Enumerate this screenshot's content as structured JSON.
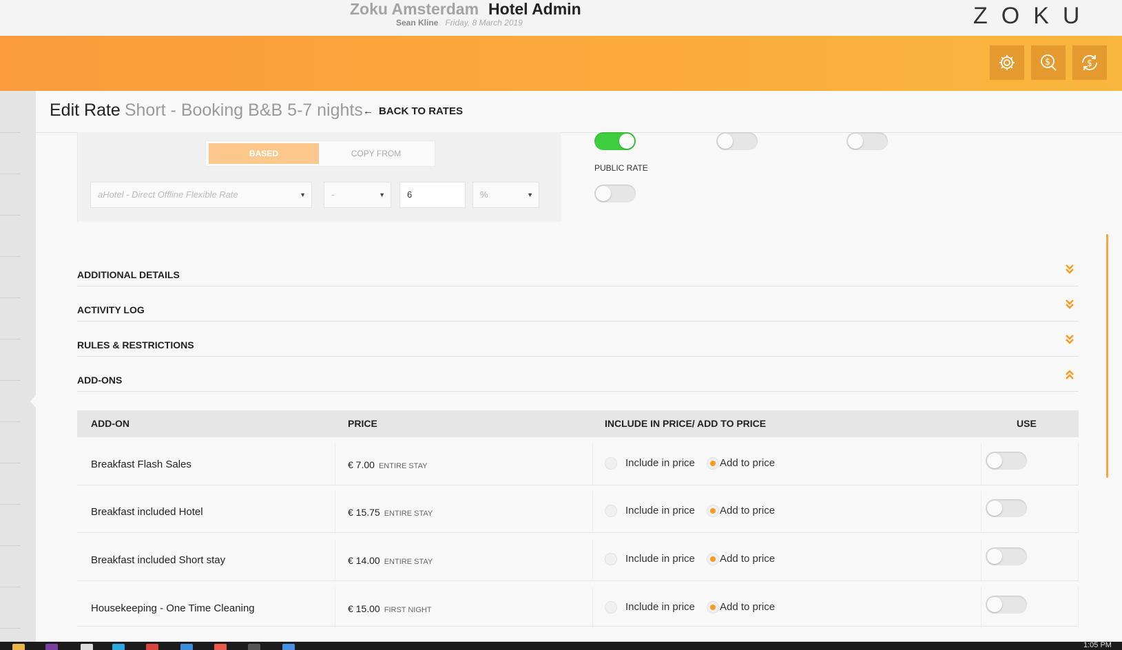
{
  "header": {
    "hotel_name": "Zoku Amsterdam",
    "app_name": "Hotel Admin",
    "user": "Sean Kline",
    "date": "Friday, 8 March 2019",
    "logo": "ZOKU"
  },
  "toolbar": {
    "icons": [
      "gear-icon",
      "dollar-search-icon",
      "dollar-refresh-icon"
    ]
  },
  "page": {
    "title_label": "Edit Rate",
    "rate_name": "Short - Booking B&B 5-7 nights",
    "back_label": "BACK TO RATES"
  },
  "based_panel": {
    "tab_based": "BASED",
    "tab_copy_from": "COPY FROM",
    "base_rate": "aHotel - Direct Offline Flexible Rate",
    "operator": "-",
    "amount": "6",
    "unit": "%"
  },
  "toggles": {
    "public_rate_label": "PUBLIC RATE",
    "row1": [
      true,
      false,
      false
    ],
    "public_rate": false
  },
  "accordion": [
    {
      "title": "ADDITIONAL DETAILS",
      "expanded": false
    },
    {
      "title": "ACTIVITY LOG",
      "expanded": false
    },
    {
      "title": "RULES & RESTRICTIONS",
      "expanded": false
    },
    {
      "title": "ADD-ONS",
      "expanded": true
    }
  ],
  "addons": {
    "columns": [
      "ADD-ON",
      "PRICE",
      "INCLUDE IN PRICE/ ADD TO PRICE",
      "USE"
    ],
    "include_label": "Include in price",
    "add_label": "Add to price",
    "rows": [
      {
        "name": "Breakfast Flash Sales",
        "price": "€ 7.00",
        "unit": "ENTIRE STAY",
        "mode": "add",
        "use": false
      },
      {
        "name": "Breakfast included Hotel",
        "price": "€ 15.75",
        "unit": "ENTIRE STAY",
        "mode": "add",
        "use": false
      },
      {
        "name": "Breakfast included Short stay",
        "price": "€ 14.00",
        "unit": "ENTIRE STAY",
        "mode": "add",
        "use": false
      },
      {
        "name": "Housekeeping - One Time Cleaning",
        "price": "€ 15.00",
        "unit": "FIRST NIGHT",
        "mode": "add",
        "use": false
      }
    ]
  },
  "colors": {
    "accent": "#fb9b3c",
    "toggle_on": "#3fce3f",
    "radio_checked": "#fb9a1f"
  },
  "taskbar": {
    "clock": "1:05 PM"
  }
}
